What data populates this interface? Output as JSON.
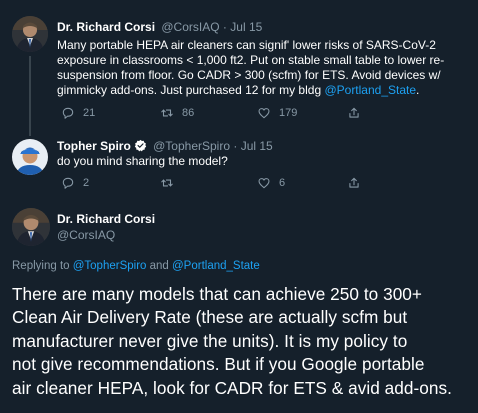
{
  "tweets": [
    {
      "name": "Dr. Richard Corsi",
      "handle": "@CorsIAQ",
      "sep": "·",
      "date": "Jul 15",
      "lines": [
        "Many portable HEPA air cleaners can signif' lower risks of SARS-CoV-2",
        "exposure in classrooms < 1,000 ft2.  Put on stable small table to lower re-",
        "suspension from floor. Go CADR > 300 (scfm) for ETS. Avoid devices w/",
        "gimmicky add-ons. Just purchased 12 for my bldg "
      ],
      "mention": "@Portland_State",
      "reply_count": "21",
      "retweet_count": "86",
      "like_count": "179"
    },
    {
      "name": "Topher Spiro",
      "handle": "@TopherSpiro",
      "sep": "·",
      "date": "Jul 15",
      "text": "do you mind sharing the model?",
      "reply_count": "2",
      "retweet_count": "",
      "like_count": "6"
    }
  ],
  "main_tweet": {
    "name": "Dr. Richard Corsi",
    "handle": "@CorsIAQ",
    "replying_prefix": "Replying to ",
    "replying_user1": "@TopherSpiro",
    "replying_and": " and ",
    "replying_user2": "@Portland_State",
    "lines": [
      "There are many models that can achieve 250 to 300+",
      "Clean Air Delivery Rate (these are actually scfm but",
      "manufacturer never give the units).  It is my policy to",
      "not give recommendations.  But if you Google portable",
      "air cleaner HEPA, look for CADR for ETS & avid add-ons."
    ]
  },
  "colors": {
    "background": "#15202b",
    "text": "#ffffff",
    "muted": "#8899a6",
    "link": "#1da1f2",
    "thread_line": "#38444d"
  },
  "icons": [
    "reply-icon",
    "retweet-icon",
    "like-icon",
    "share-icon",
    "verified-badge-icon"
  ]
}
